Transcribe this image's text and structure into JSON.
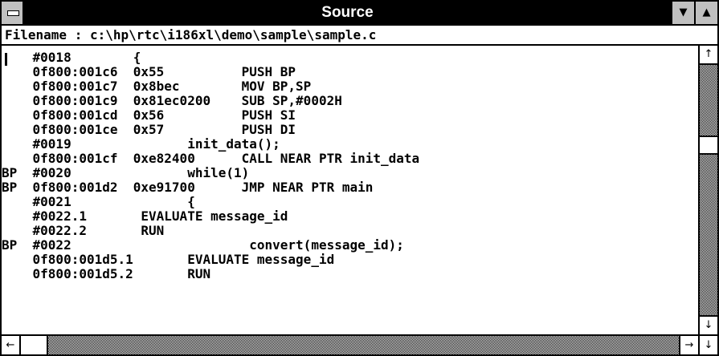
{
  "window": {
    "title": "Source",
    "filename_label": "Filename : c:\\hp\\rtc\\i186xl\\demo\\sample\\sample.c"
  },
  "icons": {
    "system_menu": "system-menu-icon",
    "minimize": "▼",
    "maximize": "▲",
    "scroll_up": "↑",
    "scroll_down": "↓",
    "scroll_left": "←",
    "scroll_right": "→"
  },
  "lines": [
    "    #0018        {",
    "    0f800:001c6  0x55          PUSH BP",
    "    0f800:001c7  0x8bec        MOV BP,SP",
    "    0f800:001c9  0x81ec0200    SUB SP,#0002H",
    "    0f800:001cd  0x56          PUSH SI",
    "    0f800:001ce  0x57          PUSH DI",
    "    #0019               init_data();",
    "    0f800:001cf  0xe82400      CALL NEAR PTR init_data",
    "BP  #0020               while(1)",
    "BP  0f800:001d2  0xe91700      JMP NEAR PTR main",
    "    #0021               {",
    "    #0022.1       EVALUATE message_id",
    "    #0022.2       RUN",
    "BP  #0022                       convert(message_id);",
    "    0f800:001d5.1       EVALUATE message_id",
    "    0f800:001d5.2       RUN"
  ]
}
